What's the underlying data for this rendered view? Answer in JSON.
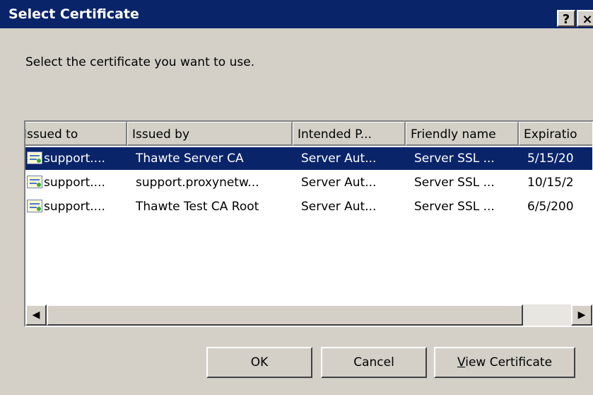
{
  "window": {
    "title": "Select Certificate",
    "help_label": "?",
    "close_label": "×"
  },
  "prompt": "Select the certificate you want to use.",
  "columns": [
    "Issued to",
    "Issued by",
    "Intended P...",
    "Friendly name",
    "Expiratio"
  ],
  "rows": [
    {
      "issued_to": "support....",
      "issued_by": "Thawte Server CA",
      "intended": "Server Aut...",
      "friendly": "Server SSL ...",
      "expiration": "5/15/20",
      "selected": true
    },
    {
      "issued_to": "support....",
      "issued_by": "support.proxynetw...",
      "intended": "Server Aut...",
      "friendly": "Server SSL ...",
      "expiration": "10/15/2",
      "selected": false
    },
    {
      "issued_to": "support....",
      "issued_by": "Thawte Test CA Root",
      "intended": "Server Aut...",
      "friendly": "Server SSL ...",
      "expiration": "6/5/200",
      "selected": false
    }
  ],
  "scrollbar": {
    "left_arrow": "◀",
    "right_arrow": "▶"
  },
  "buttons": {
    "ok": "OK",
    "cancel": "Cancel",
    "view_mnemonic": "V",
    "view_rest": "iew Certificate"
  },
  "colors": {
    "title_bar": "#0a246a",
    "selection": "#0a246a",
    "dialog_bg": "#d4d0c8"
  },
  "icons": {
    "certificate": "certificate-icon"
  }
}
